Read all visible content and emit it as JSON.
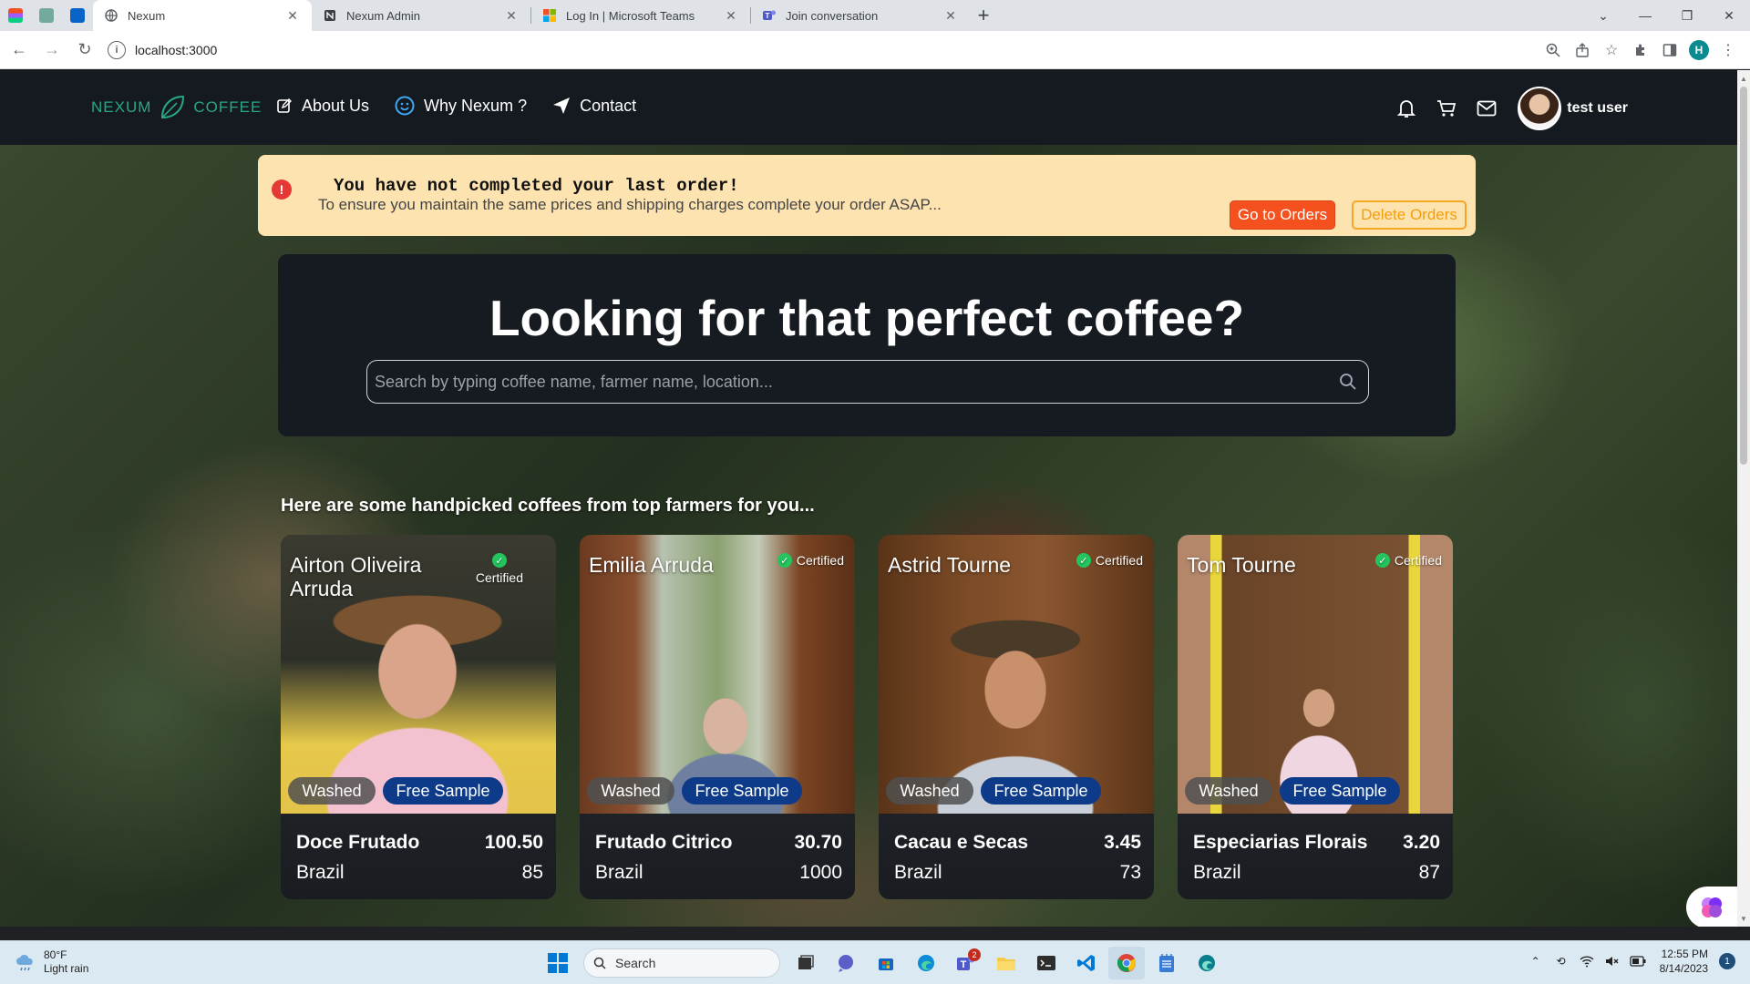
{
  "browser": {
    "tabs": [
      {
        "label": "Nexum",
        "active": true
      },
      {
        "label": "Nexum Admin",
        "active": false
      },
      {
        "label": "Log In | Microsoft Teams",
        "active": false
      },
      {
        "label": "Join conversation",
        "active": false
      }
    ],
    "url": "localhost:3000",
    "profile_initial": "H"
  },
  "site": {
    "logo_left": "NEXUM",
    "logo_right": "COFFEE",
    "nav": [
      {
        "label": "About Us",
        "icon": "edit-icon"
      },
      {
        "label": "Why Nexum ?",
        "icon": "smile-icon"
      },
      {
        "label": "Contact",
        "icon": "send-icon"
      }
    ],
    "user_name": "test user"
  },
  "alert": {
    "title": "You have not completed your last order!",
    "description": "To ensure you maintain the same prices and shipping charges complete your order ASAP...",
    "primary_button": "Go to Orders",
    "secondary_button": "Delete Orders"
  },
  "hero": {
    "title": "Looking for that perfect coffee?",
    "search_placeholder": "Search by typing coffee name, farmer name, location..."
  },
  "section_title": "Here are some handpicked coffees from top farmers for you...",
  "cards": [
    {
      "farmer": "Airton Oliveira Arruda",
      "certified": "Certified",
      "process": "Washed",
      "sample": "Free Sample",
      "coffee": "Doce Frutado",
      "price": "100.50",
      "origin": "Brazil",
      "score": "85"
    },
    {
      "farmer": "Emilia Arruda",
      "certified": "Certified",
      "process": "Washed",
      "sample": "Free Sample",
      "coffee": "Frutado Citrico",
      "price": "30.70",
      "origin": "Brazil",
      "score": "1000"
    },
    {
      "farmer": "Astrid Tourne",
      "certified": "Certified",
      "process": "Washed",
      "sample": "Free Sample",
      "coffee": "Cacau e Secas",
      "price": "3.45",
      "origin": "Brazil",
      "score": "73"
    },
    {
      "farmer": "Tom Tourne",
      "certified": "Certified",
      "process": "Washed",
      "sample": "Free Sample",
      "coffee": "Especiarias Florais",
      "price": "3.20",
      "origin": "Brazil",
      "score": "87"
    }
  ],
  "taskbar": {
    "temperature": "80°F",
    "weather": "Light rain",
    "search_label": "Search",
    "teams_badge": "2",
    "time": "12:55 PM",
    "date": "8/14/2023",
    "notifications": "1"
  },
  "colors": {
    "header_bg": "#141a20",
    "brand_green": "#27a884",
    "alert_bg": "#fde3b0",
    "primary_orange": "#f4511e",
    "sample_blue": "#0d3b8a",
    "certified_green": "#22c55e"
  }
}
